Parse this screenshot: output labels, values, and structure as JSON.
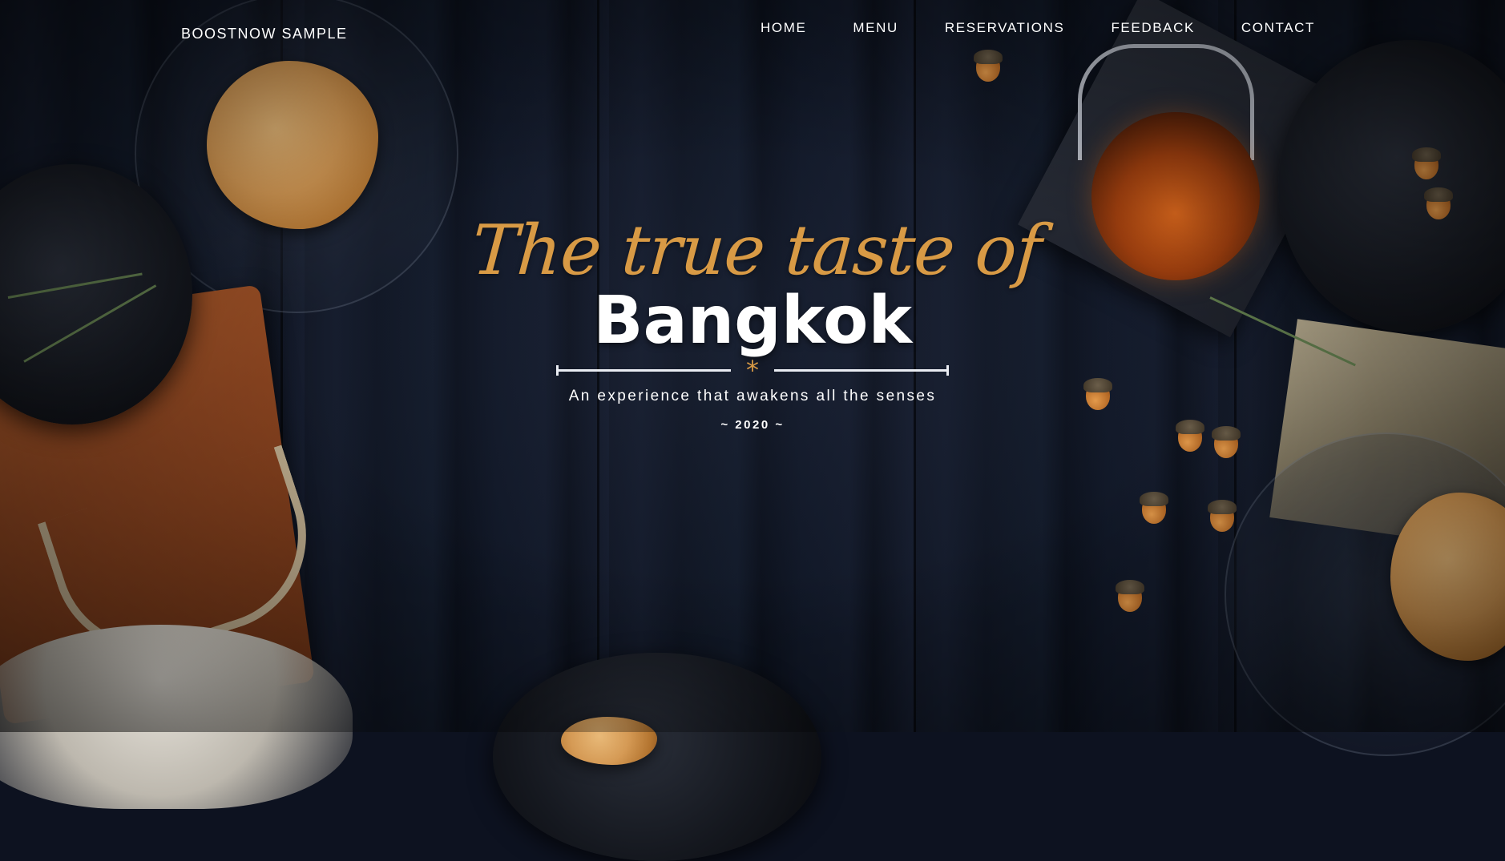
{
  "brand": {
    "name": "BOOSTNOW SAMPLE"
  },
  "nav": {
    "items": [
      {
        "label": "HOME"
      },
      {
        "label": "MENU"
      },
      {
        "label": "RESERVATIONS"
      },
      {
        "label": "FEEDBACK"
      },
      {
        "label": "CONTACT"
      }
    ]
  },
  "hero": {
    "script_title": "The true taste of",
    "city": "Bangkok",
    "divider_glyph": "*",
    "tagline": "An experience that awakens all the senses",
    "year": "~ 2020 ~"
  },
  "colors": {
    "accent": "#d89a45",
    "text": "#ffffff",
    "background": "#0d1220"
  }
}
